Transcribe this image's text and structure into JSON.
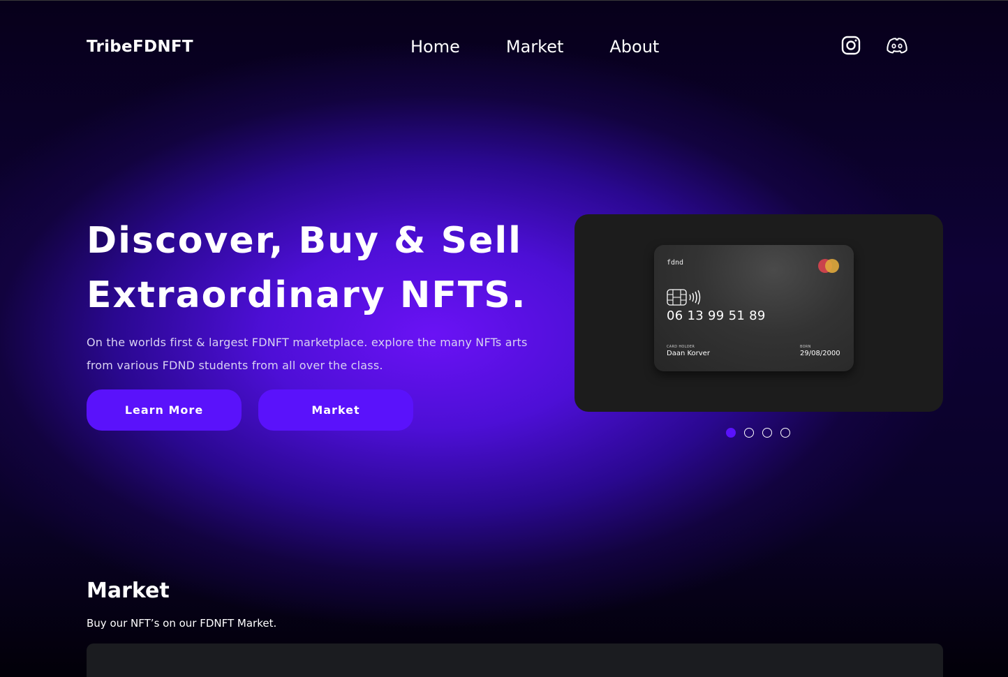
{
  "brand": "TribeFDNFT",
  "nav": {
    "items": [
      {
        "label": "Home"
      },
      {
        "label": "Market"
      },
      {
        "label": "About"
      }
    ]
  },
  "social": {
    "icons": [
      "instagram-icon",
      "discord-icon"
    ]
  },
  "hero": {
    "title_line1": "Discover, Buy & Sell",
    "title_line2": "Extraordinary NFTS.",
    "subtitle_line1": "On the worlds first & largest FDNFT marketplace. explore the many NFTs arts",
    "subtitle_line2": "from various FDND students from all over the class.",
    "buttons": {
      "learn_more": "Learn More",
      "market": "Market"
    }
  },
  "card": {
    "issuer": "fdnd",
    "number": "06 13 99 51 89",
    "holder_label": "CARD HOLDER",
    "holder_name": "Daan Korver",
    "born_label": "BORN",
    "born_date": "29/08/2000"
  },
  "carousel": {
    "total": 4,
    "active_index": 0
  },
  "market": {
    "title": "Market",
    "subtitle": "Buy our NFT’s on our FDNFT Market."
  },
  "colors": {
    "accent": "#5a12fb",
    "panel": "#1c1c1c",
    "background_dark": "#050012"
  }
}
